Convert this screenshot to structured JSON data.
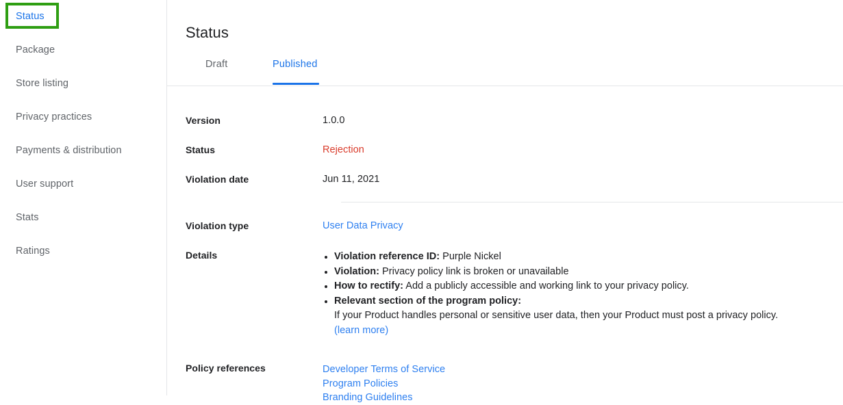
{
  "sidebar": {
    "items": [
      {
        "label": "Status",
        "active": true
      },
      {
        "label": "Package",
        "active": false
      },
      {
        "label": "Store listing",
        "active": false
      },
      {
        "label": "Privacy practices",
        "active": false
      },
      {
        "label": "Payments & distribution",
        "active": false
      },
      {
        "label": "User support",
        "active": false
      },
      {
        "label": "Stats",
        "active": false
      },
      {
        "label": "Ratings",
        "active": false
      }
    ],
    "highlight_color": "#2e9e12",
    "active_color": "#1a73e8"
  },
  "main": {
    "page_title": "Status",
    "tabs": [
      {
        "label": "Draft",
        "selected": false
      },
      {
        "label": "Published",
        "selected": true
      }
    ],
    "accent_color": "#1a73e8",
    "rows": {
      "version": {
        "label": "Version",
        "value": "1.0.0"
      },
      "status": {
        "label": "Status",
        "value": "Rejection",
        "color": "#d93b2b"
      },
      "violation_date": {
        "label": "Violation date",
        "value": "Jun 11, 2021"
      },
      "violation_type": {
        "label": "Violation type",
        "value": "User Data Privacy"
      },
      "details": {
        "label": "Details",
        "bullets": [
          {
            "term": "Violation reference ID:",
            "text": " Purple Nickel"
          },
          {
            "term": "Violation:",
            "text": " Privacy policy link is broken or unavailable"
          },
          {
            "term": "How to rectify:",
            "text": " Add a publicly accessible and working link to your privacy policy."
          },
          {
            "term": "Relevant section of the program policy:",
            "text": ""
          }
        ],
        "policy_excerpt": "If your Product handles personal or sensitive user data, then your Product must post a privacy policy.",
        "learn_more": "(learn more)"
      },
      "policy_references": {
        "label": "Policy references",
        "links": [
          "Developer Terms of Service",
          "Program Policies",
          "Branding Guidelines"
        ]
      }
    }
  }
}
